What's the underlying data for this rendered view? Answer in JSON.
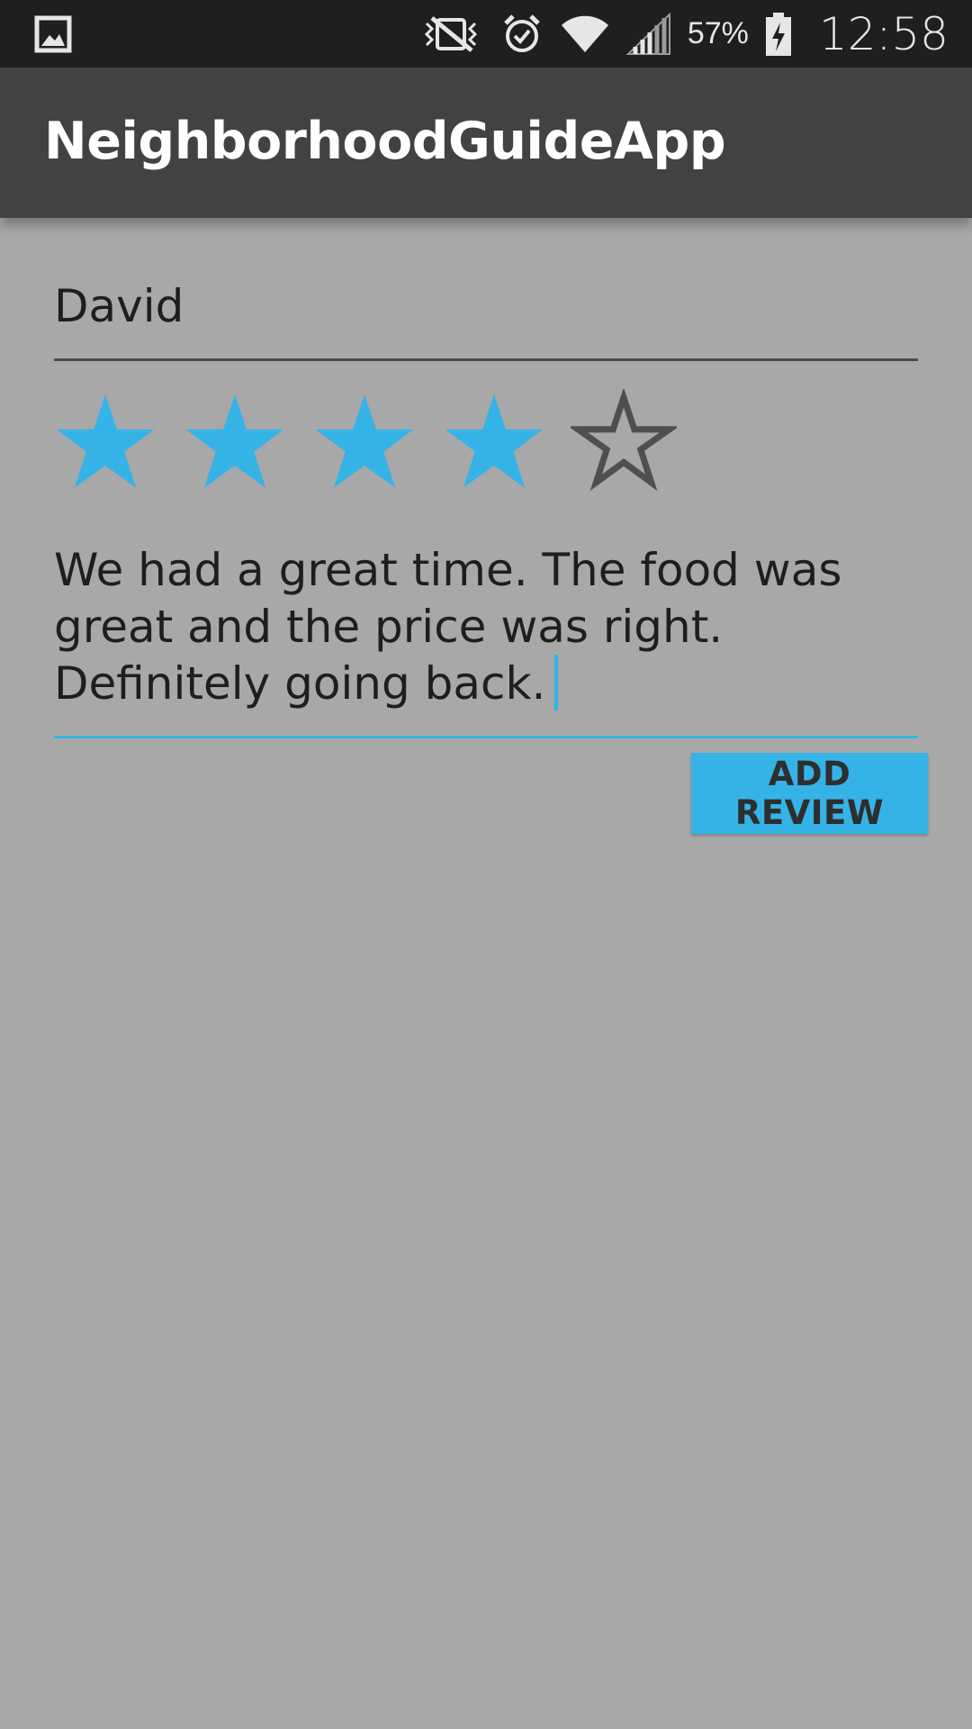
{
  "status_bar": {
    "icons": [
      "gallery-icon",
      "vibrate-mute-icon",
      "alarm-icon",
      "wifi-icon",
      "signal-icon",
      "battery-charging-icon"
    ],
    "battery_percent": "57%",
    "time": "12:58"
  },
  "app_bar": {
    "title": "NeighborhoodGuideApp"
  },
  "form": {
    "name_value": "David",
    "rating": {
      "value": 4,
      "max": 5
    },
    "review_text": "We had a great time. The food was great and the price was right. Definitely going back.",
    "submit_label": "ADD REVIEW"
  },
  "colors": {
    "accent": "#35b3e6",
    "background": "#a8a8a8",
    "app_bar": "#424242",
    "status_bar": "#1f1f1f",
    "empty_star_outline": "#4f4f4f"
  }
}
